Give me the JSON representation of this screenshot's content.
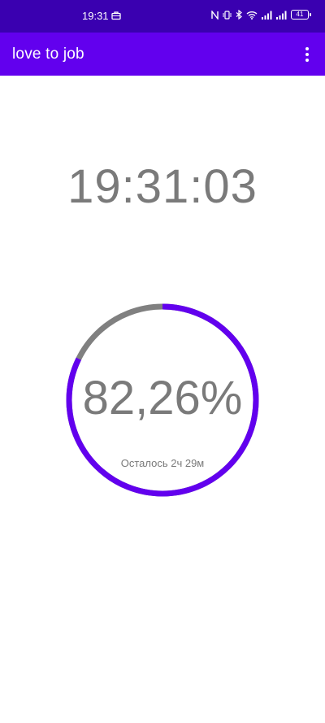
{
  "status_bar": {
    "time": "19:31",
    "battery": "41",
    "icons": [
      "briefcase-icon",
      "nfc-icon",
      "vibrate-icon",
      "bluetooth-icon",
      "wifi-icon",
      "signal-icon",
      "signal-icon",
      "battery-icon"
    ]
  },
  "app_bar": {
    "title": "love to job",
    "menu_icon": "more-vert-icon"
  },
  "main": {
    "clock": "19:31:03",
    "progress_text": "82,26%",
    "progress_fraction": 0.8226,
    "remaining": "Осталось 2ч 29м"
  },
  "colors": {
    "status_bar": "#3a00b0",
    "app_bar": "#6200ee",
    "progress": "#6200ee",
    "track": "#808080",
    "text": "#7a7a7a"
  }
}
